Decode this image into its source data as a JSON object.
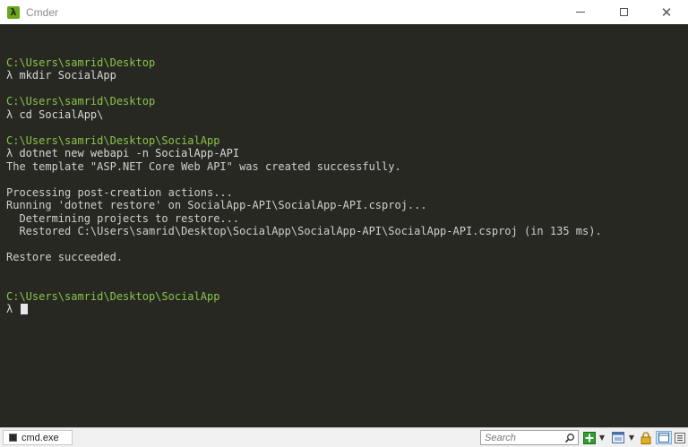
{
  "window": {
    "title": "Cmder",
    "app_icon_glyph": "λ",
    "controls": [
      "minimize-icon",
      "maximize-icon",
      "close-icon"
    ]
  },
  "colors": {
    "terminal_bg": "#272822",
    "prompt_path": "#8bc34a",
    "text": "#d8d8d8",
    "accent_green": "#6aa51d"
  },
  "terminal": {
    "lines": [
      {
        "text": "",
        "kind": "blank"
      },
      {
        "text": "C:\\Users\\samrid\\Desktop",
        "kind": "path"
      },
      {
        "text": "λ mkdir SocialApp",
        "kind": "cmd"
      },
      {
        "text": "",
        "kind": "blank"
      },
      {
        "text": "C:\\Users\\samrid\\Desktop",
        "kind": "path"
      },
      {
        "text": "λ cd SocialApp\\",
        "kind": "cmd"
      },
      {
        "text": "",
        "kind": "blank"
      },
      {
        "text": "C:\\Users\\samrid\\Desktop\\SocialApp",
        "kind": "path"
      },
      {
        "text": "λ dotnet new webapi -n SocialApp-API",
        "kind": "cmd"
      },
      {
        "text": "The template \"ASP.NET Core Web API\" was created successfully.",
        "kind": "out"
      },
      {
        "text": "",
        "kind": "blank"
      },
      {
        "text": "Processing post-creation actions...",
        "kind": "out"
      },
      {
        "text": "Running 'dotnet restore' on SocialApp-API\\SocialApp-API.csproj...",
        "kind": "out"
      },
      {
        "text": "  Determining projects to restore...",
        "kind": "out"
      },
      {
        "text": "  Restored C:\\Users\\samrid\\Desktop\\SocialApp\\SocialApp-API\\SocialApp-API.csproj (in 135 ms).",
        "kind": "out"
      },
      {
        "text": "",
        "kind": "blank"
      },
      {
        "text": "Restore succeeded.",
        "kind": "out"
      },
      {
        "text": "",
        "kind": "blank"
      },
      {
        "text": "",
        "kind": "blank"
      },
      {
        "text": "C:\\Users\\samrid\\Desktop\\SocialApp",
        "kind": "path"
      },
      {
        "text": "λ ",
        "kind": "prompt"
      }
    ]
  },
  "statusbar": {
    "tab_label": "cmd.exe",
    "search_placeholder": "Search",
    "icons": [
      "search-icon",
      "new-console-icon",
      "dropdown-icon",
      "view-icon",
      "dropdown-icon",
      "lock-icon",
      "layout-icon",
      "menu-icon"
    ]
  }
}
